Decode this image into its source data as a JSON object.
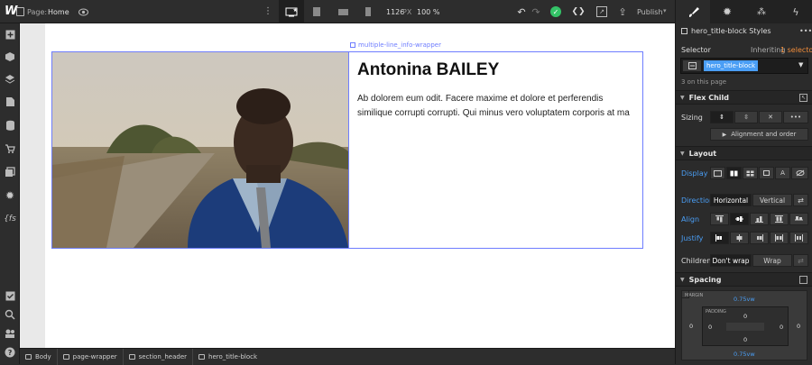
{
  "topbar": {
    "logo": "W",
    "page_label": "Page:",
    "page_name": "Home",
    "width_px": "1126",
    "width_unit": "PX",
    "zoom": "100 %",
    "publish_label": "Publish"
  },
  "left_icons": [
    "add-icon",
    "box-icon",
    "layers-icon",
    "pages-icon",
    "cms-icon",
    "ecommerce-icon",
    "assets-icon",
    "settings-icon",
    "logic-icon",
    "tasks-icon",
    "search-icon",
    "audit-icon",
    "help-icon"
  ],
  "canvas": {
    "wrapper_label": "multiple-line_info-wrapper",
    "hero_name": "Antonina BAILEY",
    "hero_body": "Ab dolorem eum odit. Facere maxime et dolore et perferendis similique corrupti corrupti. Qui minus vero voluptatem corporis at ma"
  },
  "breadcrumbs": [
    "Body",
    "page-wrapper",
    "section_header",
    "hero_title-block"
  ],
  "panel": {
    "tabs": [
      "style-brush-icon",
      "gear-icon",
      "interactions-icon",
      "lightning-icon"
    ],
    "styles_title": "hero_title-block Styles",
    "more": "•••",
    "selector_label": "Selector",
    "inheriting_text": "Inheriting",
    "inheriting_count": "1 selector",
    "selector_chip": "hero_title-block",
    "on_page": "3 on this page",
    "flex_child": {
      "title": "Flex Child",
      "sizing_label": "Sizing",
      "more": "•••",
      "alignment_link": "Alignment and order"
    },
    "layout": {
      "title": "Layout",
      "display_label": "Display",
      "direction_label": "Direction",
      "direction_options": [
        "Horizontal",
        "Vertical"
      ],
      "align_label": "Align",
      "justify_label": "Justify",
      "children_label": "Children",
      "wrap_options": [
        "Don't wrap",
        "Wrap"
      ]
    },
    "spacing": {
      "title": "Spacing",
      "margin_label": "MARGIN",
      "margin_top": "0.75vw",
      "margin_bottom": "0.75vw",
      "margin_left": "0",
      "margin_right": "0",
      "padding_label": "PADDING",
      "padding_top": "0",
      "padding_bottom": "0",
      "padding_left": "0",
      "padding_right": "0"
    }
  },
  "colors": {
    "accent": "#4a9ef5",
    "selection": "#6e7dff",
    "orange": "#f08c3a",
    "publish_check": "#34c367"
  }
}
